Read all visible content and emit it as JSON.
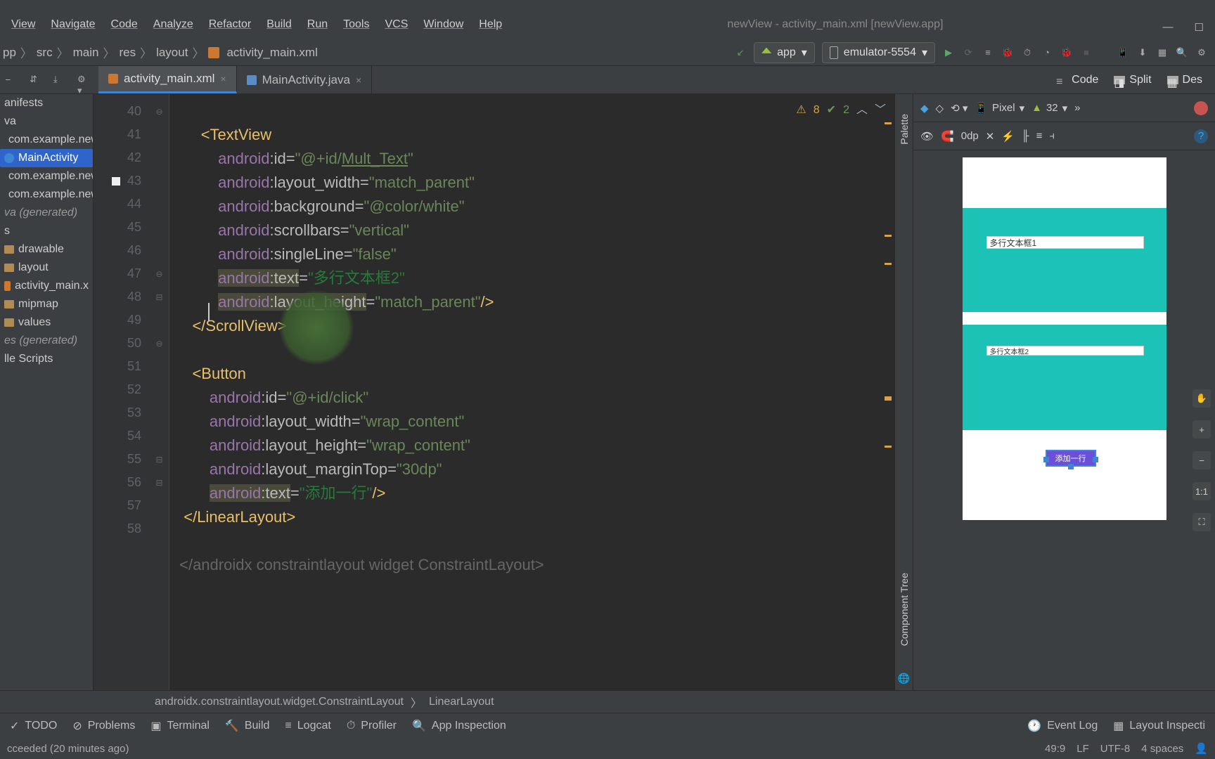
{
  "window": {
    "title": "newView - activity_main.xml [newView.app]"
  },
  "menu": [
    "View",
    "Navigate",
    "Code",
    "Analyze",
    "Refactor",
    "Build",
    "Run",
    "Tools",
    "VCS",
    "Window",
    "Help"
  ],
  "breadcrumbs": [
    "pp",
    "src",
    "main",
    "res",
    "layout",
    "activity_main.xml"
  ],
  "runConfig": {
    "app": "app",
    "device": "emulator-5554"
  },
  "editorTabs": [
    {
      "label": "activity_main.xml",
      "active": true,
      "kind": "xml"
    },
    {
      "label": "MainActivity.java",
      "active": false,
      "kind": "java"
    }
  ],
  "designerTabs": [
    "Code",
    "Split",
    "Des"
  ],
  "projectTree": {
    "items": [
      {
        "label": "anifests",
        "type": "folder"
      },
      {
        "label": "va",
        "type": "folder"
      },
      {
        "label": "com.example.new",
        "type": "folder",
        "indent": 1
      },
      {
        "label": "MainActivity",
        "type": "class",
        "selected": true,
        "indent": 2
      },
      {
        "label": "com.example.new",
        "type": "folder",
        "indent": 1
      },
      {
        "label": "com.example.new",
        "type": "folder",
        "indent": 1
      },
      {
        "label": "va (generated)",
        "type": "gen",
        "italic": true
      },
      {
        "label": "s",
        "type": "folder"
      },
      {
        "label": "drawable",
        "type": "folder",
        "indent": 1
      },
      {
        "label": "layout",
        "type": "folder",
        "indent": 1
      },
      {
        "label": "activity_main.x",
        "type": "file",
        "indent": 2
      },
      {
        "label": "mipmap",
        "type": "folder",
        "indent": 1
      },
      {
        "label": "values",
        "type": "folder",
        "indent": 1
      },
      {
        "label": "es (generated)",
        "type": "gen",
        "italic": true
      },
      {
        "label": "lle Scripts",
        "type": "folder"
      }
    ]
  },
  "editor": {
    "firstLine": 40,
    "warnings": "8",
    "oks": "2",
    "bottomBreadcrumb": [
      "androidx.constraintlayout.widget.ConstraintLayout",
      "LinearLayout"
    ]
  },
  "designTools": {
    "device": "Pixel",
    "api": "32",
    "zoom": "0dp"
  },
  "preview": {
    "textbox1": "多行文本框1",
    "textbox2": "多行文本框2",
    "buttonText": "添加一行"
  },
  "bottomBar": [
    "TODO",
    "Problems",
    "Terminal",
    "Build",
    "Logcat",
    "Profiler",
    "App Inspection"
  ],
  "bottomRight": [
    "Event Log",
    "Layout Inspecti"
  ],
  "status": {
    "left": "cceeded (20 minutes ago)",
    "pos": "49:9",
    "eol": "LF",
    "enc": "UTF-8",
    "indent": "4 spaces"
  },
  "chart_data": null
}
